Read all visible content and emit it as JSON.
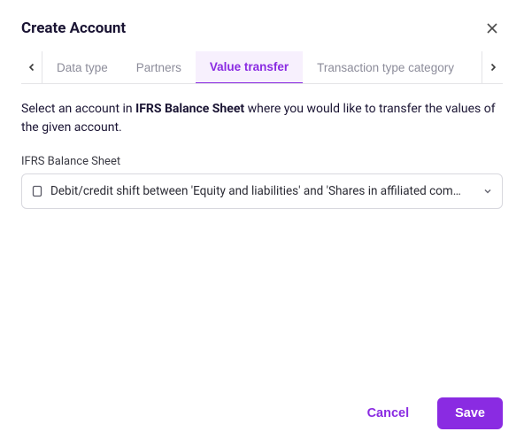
{
  "header": {
    "title": "Create Account"
  },
  "tabs": {
    "items": [
      {
        "label": "Data type",
        "active": false
      },
      {
        "label": "Partners",
        "active": false
      },
      {
        "label": "Value transfer",
        "active": true
      },
      {
        "label": "Transaction type category",
        "active": false
      }
    ]
  },
  "body": {
    "desc_prefix": "Select an account in ",
    "desc_bold": "IFRS Balance Sheet",
    "desc_suffix": " where you would like to transfer the values of the given account.",
    "field_label": "IFRS Balance Sheet",
    "select_value": "Debit/credit shift between 'Equity and liabilities' and 'Shares in affiliated com…"
  },
  "footer": {
    "cancel": "Cancel",
    "save": "Save"
  }
}
